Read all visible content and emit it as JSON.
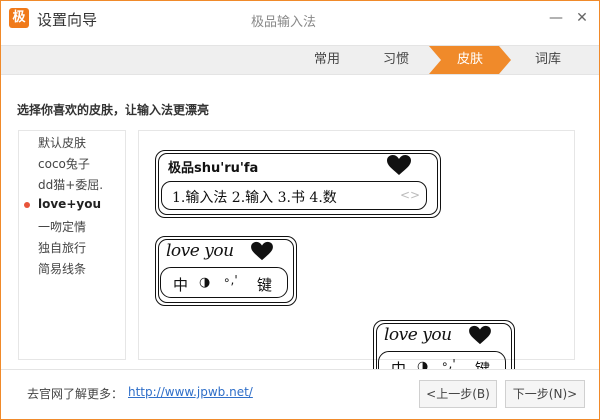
{
  "titlebar": {
    "logo_text": "极",
    "wizard_title": "设置向导",
    "app_title": "极品输入法",
    "minimize_glyph": "—",
    "close_glyph": "✕"
  },
  "steps": [
    {
      "label": "常用",
      "active": false
    },
    {
      "label": "习惯",
      "active": false
    },
    {
      "label": "皮肤",
      "active": true
    },
    {
      "label": "词库",
      "active": false
    }
  ],
  "heading": "选择你喜欢的皮肤，让输入法更漂亮",
  "skin_list": [
    {
      "label": "默认皮肤",
      "selected": false
    },
    {
      "label": "coco兔子",
      "selected": false
    },
    {
      "label": "dd猫+委屈.",
      "selected": false
    },
    {
      "label": "love+you",
      "selected": true
    },
    {
      "label": "一吻定情",
      "selected": false
    },
    {
      "label": "独自旅行",
      "selected": false
    },
    {
      "label": "简易线条",
      "selected": false
    }
  ],
  "preview": {
    "main": {
      "input_text": "极品shu'ru'fa",
      "candidates": "1.输入法  2.输入  3.书  4.数",
      "page_arrows": "<>"
    },
    "mini": {
      "logo_text": "love you",
      "key_zhong": "中",
      "key_punct": "◑",
      "key_dot": "∘,'",
      "key_jian": "键"
    }
  },
  "footer": {
    "visit_text": "去官网了解更多：",
    "url": "http://www.jpwb.net/",
    "prev_label": "<上一步(B)",
    "next_label": "下一步(N)>"
  },
  "colors": {
    "accent": "#f08a2a",
    "link": "#2f6fc9",
    "selected_dot": "#e8543a"
  }
}
